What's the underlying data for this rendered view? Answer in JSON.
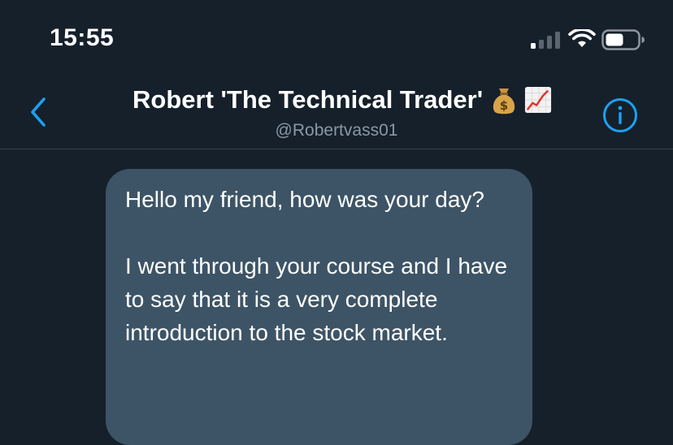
{
  "status_bar": {
    "time": "15:55",
    "icons": [
      "cellular-signal-icon",
      "wifi-icon",
      "battery-icon"
    ]
  },
  "header": {
    "back_icon": "chevron-left-icon",
    "title": "Robert 'The Technical Trader'",
    "title_emojis": [
      "money-bag-icon",
      "chart-increasing-icon"
    ],
    "handle": "@Robertvass01",
    "info_icon": "info-circle-icon"
  },
  "conversation": {
    "messages": [
      {
        "paragraphs": [
          "Hello my friend, how was your day?",
          "I went through your course and I have to say that it is a very complete introduction to the stock market."
        ]
      }
    ]
  },
  "colors": {
    "background": "#15202b",
    "accent": "#1da1f2",
    "bubble": "#3d5466",
    "secondary_text": "#8899a6",
    "divider": "#38444d"
  }
}
